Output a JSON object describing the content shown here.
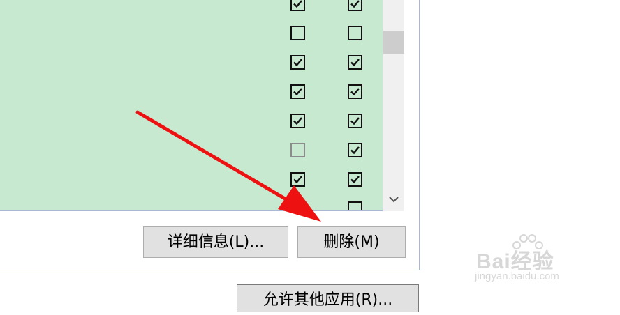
{
  "rows": [
    {
      "col1": "checked",
      "col2": "checked"
    },
    {
      "col1": "unchecked",
      "col2": "unchecked"
    },
    {
      "col1": "checked",
      "col2": "checked"
    },
    {
      "col1": "checked",
      "col2": "checked"
    },
    {
      "col1": "checked",
      "col2": "checked"
    },
    {
      "col1": "disabled-unchecked",
      "col2": "checked"
    },
    {
      "col1": "checked",
      "col2": "checked"
    },
    {
      "col1": "checked",
      "col2": "unchecked"
    }
  ],
  "buttons": {
    "details": "详细信息(L)...",
    "delete": "删除(M)",
    "allow_other": "允许其他应用(R)..."
  },
  "watermark": {
    "brand": "Bai经验",
    "url": "jingyan.baidu.com"
  },
  "colors": {
    "list_bg": "#c6e9cf",
    "arrow": "#ee1111",
    "button_bg": "#e1e1e1"
  },
  "icons": {
    "scroll_down": "chevron-down-icon",
    "annotation": "red-arrow-icon"
  }
}
